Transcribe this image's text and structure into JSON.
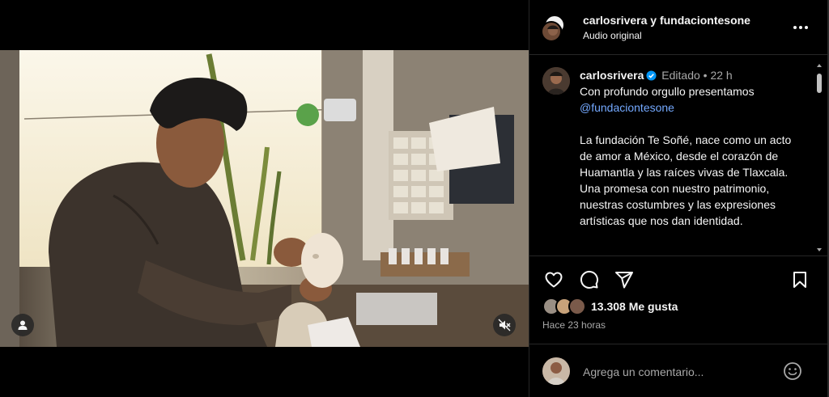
{
  "post": {
    "header": {
      "title": "carlosrivera y fundaciontesone",
      "subtitle": "Audio original",
      "more_icon": "more-horizontal-icon"
    },
    "caption": {
      "username": "carlosrivera",
      "verified_icon": "verified-badge-icon",
      "edited": "Editado",
      "separator": "•",
      "age": "22 h",
      "line1": "Con profundo orgullo presentamos",
      "mention": "@fundaciontesone",
      "para1": "La fundación Te Soñé, nace como un acto de amor a México, desde el corazón de Huamantla y las raíces vivas de Tlaxcala.",
      "para2": "Una promesa con nuestro patrimonio, nuestras costumbres y las expresiones artísticas que nos dan identidad."
    },
    "actions": {
      "like_icon": "heart-icon",
      "comment_icon": "comment-icon",
      "share_icon": "share-icon",
      "save_icon": "bookmark-icon"
    },
    "likes": {
      "text": "13.308 Me gusta"
    },
    "time": "Hace 23 horas",
    "comment": {
      "placeholder": "Agrega un comentario...",
      "emoji_icon": "emoji-icon"
    },
    "video": {
      "tag_icon": "user-tag-icon",
      "mute_icon": "muted-speaker-icon"
    }
  },
  "colors": {
    "background": "#000000",
    "text": "#f5f5f5",
    "secondary_text": "#a8a8a8",
    "link": "#74a9ff",
    "verified": "#0095f6",
    "divider": "#262626"
  }
}
